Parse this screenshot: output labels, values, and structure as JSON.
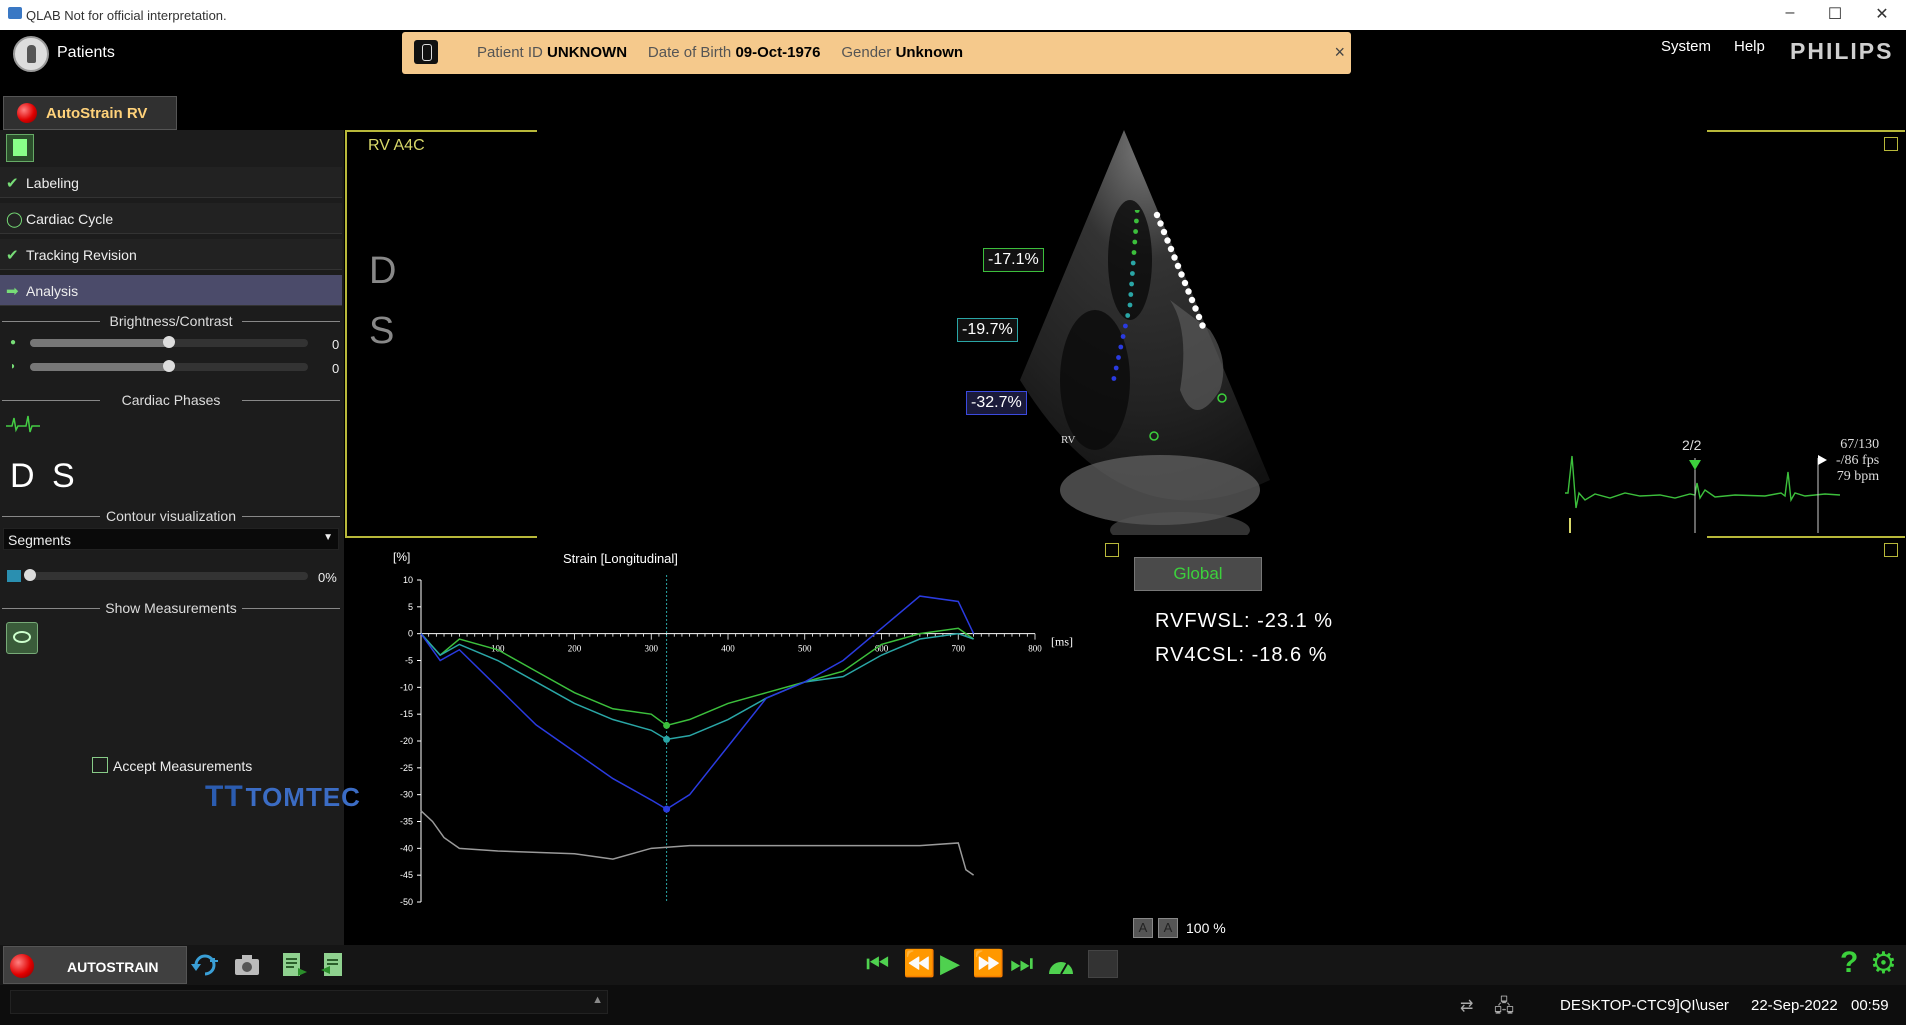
{
  "window": {
    "title": "QLAB Not for official interpretation.",
    "controls": [
      "–",
      "☐",
      "✕"
    ]
  },
  "header": {
    "patients_label": "Patients",
    "patient": {
      "id_label": "Patient ID",
      "id_value": "UNKNOWN",
      "dob_label": "Date of Birth",
      "dob_value": "09-Oct-1976",
      "gender_label": "Gender",
      "gender_value": "Unknown",
      "close": "×"
    },
    "menu": {
      "system": "System",
      "help": "Help"
    },
    "brand": "PHILIPS"
  },
  "app_tab": {
    "label": "AutoStrain RV"
  },
  "workflow": {
    "steps": [
      {
        "label": "Labeling",
        "state": "done",
        "icon": "check-icon"
      },
      {
        "label": "Cardiac Cycle",
        "state": "pending",
        "icon": "circle-icon"
      },
      {
        "label": "Tracking Revision",
        "state": "done",
        "icon": "check-icon"
      },
      {
        "label": "Analysis",
        "state": "active",
        "icon": "arrow-right-icon"
      }
    ]
  },
  "brightness_contrast": {
    "heading": "Brightness/Contrast",
    "brightness": {
      "value": "0",
      "level": 0.5
    },
    "contrast": {
      "value": "0",
      "level": 0.5
    }
  },
  "cardiac_phases": {
    "heading": "Cardiac Phases",
    "phases": "D S"
  },
  "contour": {
    "heading": "Contour visualization",
    "selected": "Segments",
    "opacity": {
      "value": "0%",
      "level": 0.0
    }
  },
  "show_measurements": {
    "heading": "Show Measurements"
  },
  "accept_measurements": {
    "label": "Accept Measurements",
    "checked": false
  },
  "logo": {
    "text": "TOMTEC"
  },
  "viewport": {
    "view_label": "RV A4C",
    "phase_d": "D",
    "phase_s": "S",
    "segment_strains": [
      "-17.1%",
      "-19.7%",
      "-32.7%"
    ],
    "rv_marker": "RV",
    "frame": "2/2",
    "frame_info": [
      "67/130",
      "-/86 fps",
      "79 bpm"
    ]
  },
  "measurements": {
    "tab": "Global",
    "items": [
      {
        "name": "RVFWSL:",
        "value": "-23.1 %"
      },
      {
        "name": "RV4CSL:",
        "value": "-18.6 %"
      }
    ]
  },
  "zoom": {
    "a1": "A",
    "a2": "A",
    "value": "100 %"
  },
  "bottom": {
    "autostrain_label": "AUTOSTRAIN"
  },
  "status": {
    "machine": "DESKTOP-CTC9]QI\\user",
    "date": "22-Sep-2022",
    "time": "00:59"
  },
  "colors": {
    "accent": "#b8b83a",
    "green": "#3cd13c",
    "teal": "#2aa6a6",
    "blue": "#1f2fd6",
    "orange_bar": "#f5c98c"
  },
  "chart_data": {
    "type": "line",
    "title": "Strain [Longitudinal]",
    "ylabel": "[%]",
    "xlabel": "[ms]",
    "xlim": [
      0,
      800
    ],
    "ylim": [
      -50,
      10
    ],
    "x_ticks": [
      100,
      200,
      300,
      400,
      500,
      600,
      700,
      800
    ],
    "y_ticks": [
      10,
      5,
      0,
      -5,
      -10,
      -15,
      -20,
      -25,
      -30,
      -35,
      -40,
      -45,
      -50
    ],
    "marker_x": 320,
    "series": [
      {
        "color": "#3cbf3c",
        "x": [
          0,
          25,
          50,
          100,
          150,
          200,
          250,
          300,
          320,
          350,
          400,
          450,
          500,
          550,
          600,
          650,
          700,
          720
        ],
        "y": [
          0,
          -4,
          -1,
          -3,
          -7,
          -11,
          -14,
          -15,
          -17.1,
          -16,
          -13,
          -11,
          -9,
          -7,
          -2,
          0,
          1,
          -1
        ]
      },
      {
        "color": "#2aa6a6",
        "x": [
          0,
          25,
          50,
          100,
          150,
          200,
          250,
          300,
          320,
          350,
          400,
          450,
          500,
          550,
          600,
          650,
          700,
          720
        ],
        "y": [
          0,
          -4,
          -2,
          -5,
          -9,
          -13,
          -16,
          -18,
          -19.7,
          -19,
          -16,
          -12,
          -9,
          -8,
          -4,
          -1,
          0,
          -1
        ]
      },
      {
        "color": "#2a3be0",
        "x": [
          0,
          25,
          50,
          100,
          150,
          200,
          250,
          300,
          320,
          350,
          400,
          450,
          500,
          550,
          600,
          650,
          700,
          720
        ],
        "y": [
          0,
          -5,
          -3,
          -10,
          -17,
          -22,
          -27,
          -31,
          -32.7,
          -30,
          -21,
          -12,
          -9,
          -5,
          1,
          7,
          6,
          0
        ]
      },
      {
        "color": "#9a9a9a",
        "x": [
          0,
          15,
          30,
          50,
          100,
          200,
          250,
          300,
          350,
          400,
          450,
          500,
          600,
          650,
          700,
          710,
          720
        ],
        "y": [
          -33,
          -35,
          -38,
          -40,
          -40.5,
          -41,
          -42,
          -40,
          -39.5,
          -39.5,
          -39.5,
          -39.5,
          -39.5,
          -39.5,
          -39,
          -44,
          -45
        ]
      }
    ]
  }
}
